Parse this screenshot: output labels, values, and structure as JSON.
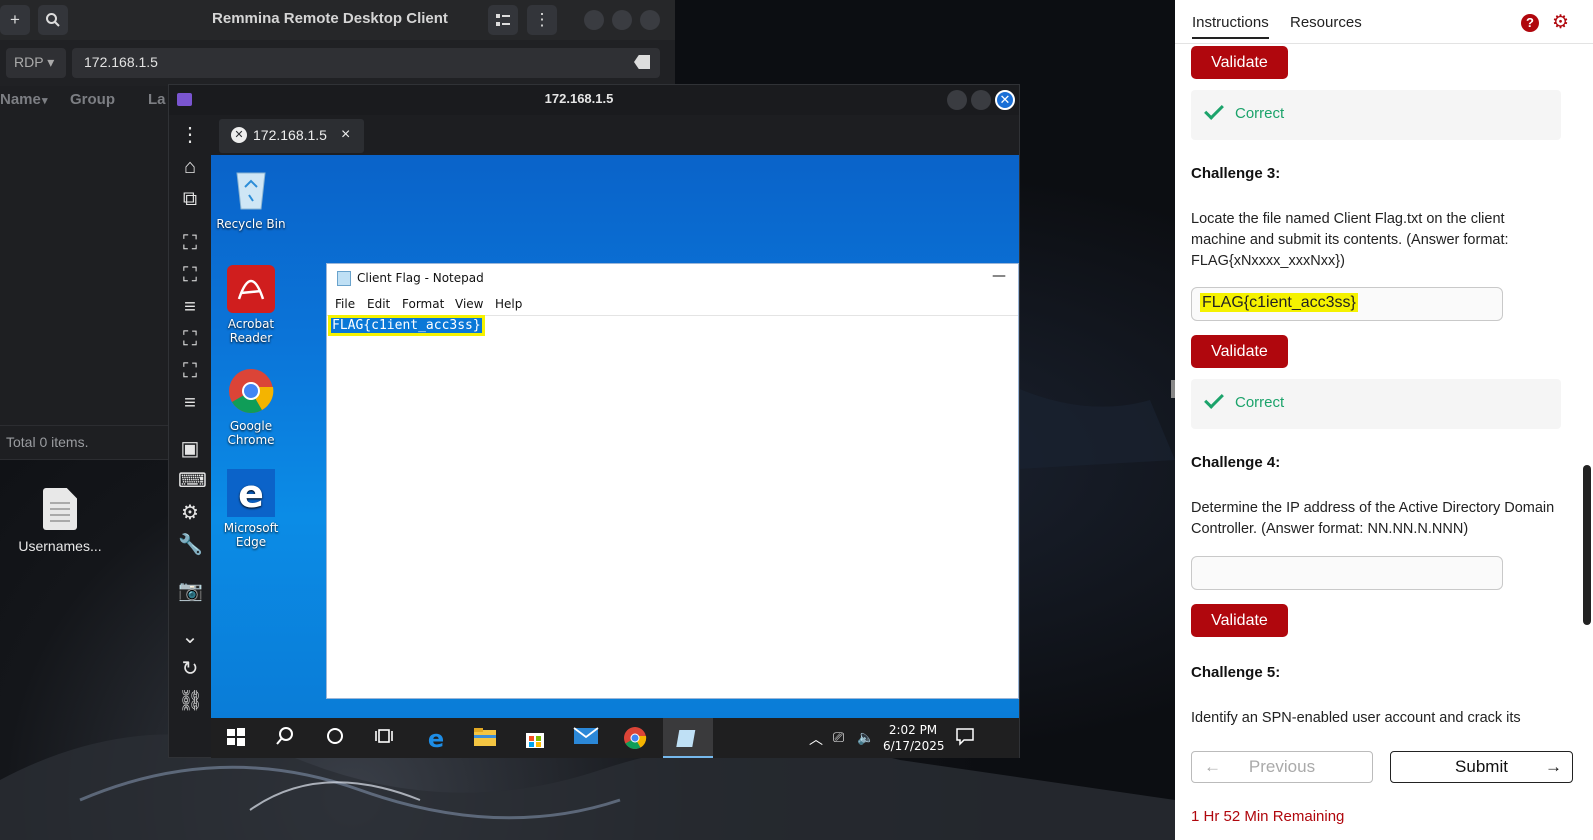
{
  "remmina": {
    "title": "Remmina Remote Desktop Client",
    "protocol": "RDP",
    "address": "172.168.1.5",
    "columns": [
      "Name",
      "Group",
      "La"
    ],
    "status": "Total 0 items."
  },
  "desktop": {
    "file_label": "Usernames..."
  },
  "rdp": {
    "window_title": "172.168.1.5",
    "tab_label": "172.168.1.5",
    "tab_close": "×"
  },
  "windows": {
    "icons": [
      "Recycle Bin",
      "Acrobat Reader",
      "Google Chrome",
      "Microsoft Edge"
    ],
    "notepad": {
      "title": "Client Flag - Notepad",
      "menu": [
        "File",
        "Edit",
        "Format",
        "View",
        "Help"
      ],
      "content": "FLAG{c1ient_acc3ss}"
    },
    "clock": {
      "time": "2:02 PM",
      "date": "6/17/2025"
    }
  },
  "panel": {
    "tabs": [
      "Instructions",
      "Resources"
    ],
    "validate_label": "Validate",
    "correct_label": "Correct",
    "challenge3": {
      "title": "Challenge 3:",
      "text": "Locate the file named Client Flag.txt on the client machine and submit its contents. (Answer format: FLAG{xNxxxx_xxxNxx})",
      "answer": "FLAG{c1ient_acc3ss}"
    },
    "challenge4": {
      "title": "Challenge 4:",
      "text": "Determine the IP address of the Active Directory Domain Controller. (Answer format: NN.NN.N.NNN)",
      "answer": ""
    },
    "challenge5": {
      "title": "Challenge 5:",
      "text": "Identify an SPN-enabled user account and crack its"
    },
    "previous_label": "Previous",
    "submit_label": "Submit",
    "timer": "1 Hr 52 Min Remaining",
    "accent": "#b0070d",
    "success": "#1ca36b"
  }
}
